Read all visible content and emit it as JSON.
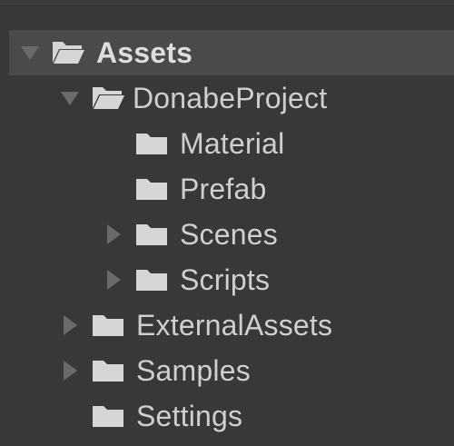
{
  "project_tree": {
    "items": [
      {
        "label": "Assets",
        "expanded": true,
        "icon": "folder-open-icon",
        "selected": true
      },
      {
        "label": "DonabeProject",
        "expanded": true,
        "icon": "folder-open-icon"
      },
      {
        "label": "Material",
        "icon": "folder-icon"
      },
      {
        "label": "Prefab",
        "icon": "folder-icon"
      },
      {
        "label": "Scenes",
        "expanded": false,
        "icon": "folder-icon"
      },
      {
        "label": "Scripts",
        "expanded": false,
        "icon": "folder-icon"
      },
      {
        "label": "ExternalAssets",
        "expanded": false,
        "icon": "folder-icon"
      },
      {
        "label": "Samples",
        "expanded": false,
        "icon": "folder-icon"
      },
      {
        "label": "Settings",
        "icon": "folder-icon"
      }
    ]
  },
  "colors": {
    "background": "#383838",
    "selection": "#4a4a4a",
    "text": "#cfcfcf",
    "icon": "#cfcfcf",
    "arrow": "#6a6a6a"
  }
}
